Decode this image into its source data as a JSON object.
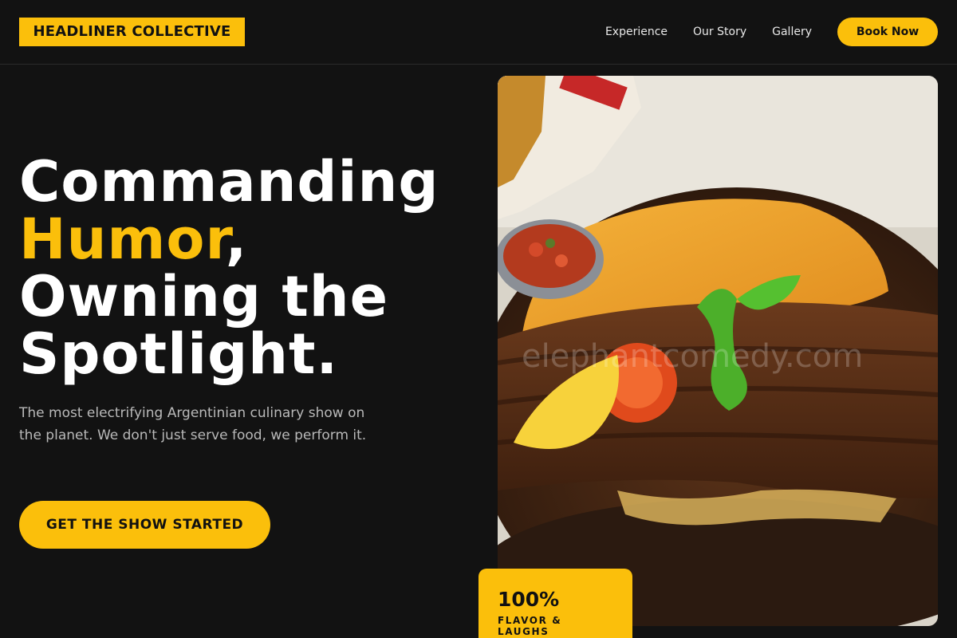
{
  "header": {
    "logo": "HEADLINER COLLECTIVE",
    "nav": [
      "Experience",
      "Our Story",
      "Gallery"
    ],
    "cta": "Book Now"
  },
  "hero": {
    "headline_line1": "Commanding",
    "headline_accent": "Humor",
    "headline_comma": ",",
    "headline_line3": "Owning the",
    "headline_line4": "Spotlight.",
    "subtext": "The most electrifying Argentinian culinary show on the planet. We don't just serve food, we perform it.",
    "cta": "GET THE SHOW STARTED"
  },
  "image": {
    "watermark": "elephantcomedy.com"
  },
  "stat": {
    "value": "100%",
    "label": "FLAVOR & LAUGHS"
  },
  "colors": {
    "accent": "#fbbf0b",
    "background": "#121212"
  }
}
